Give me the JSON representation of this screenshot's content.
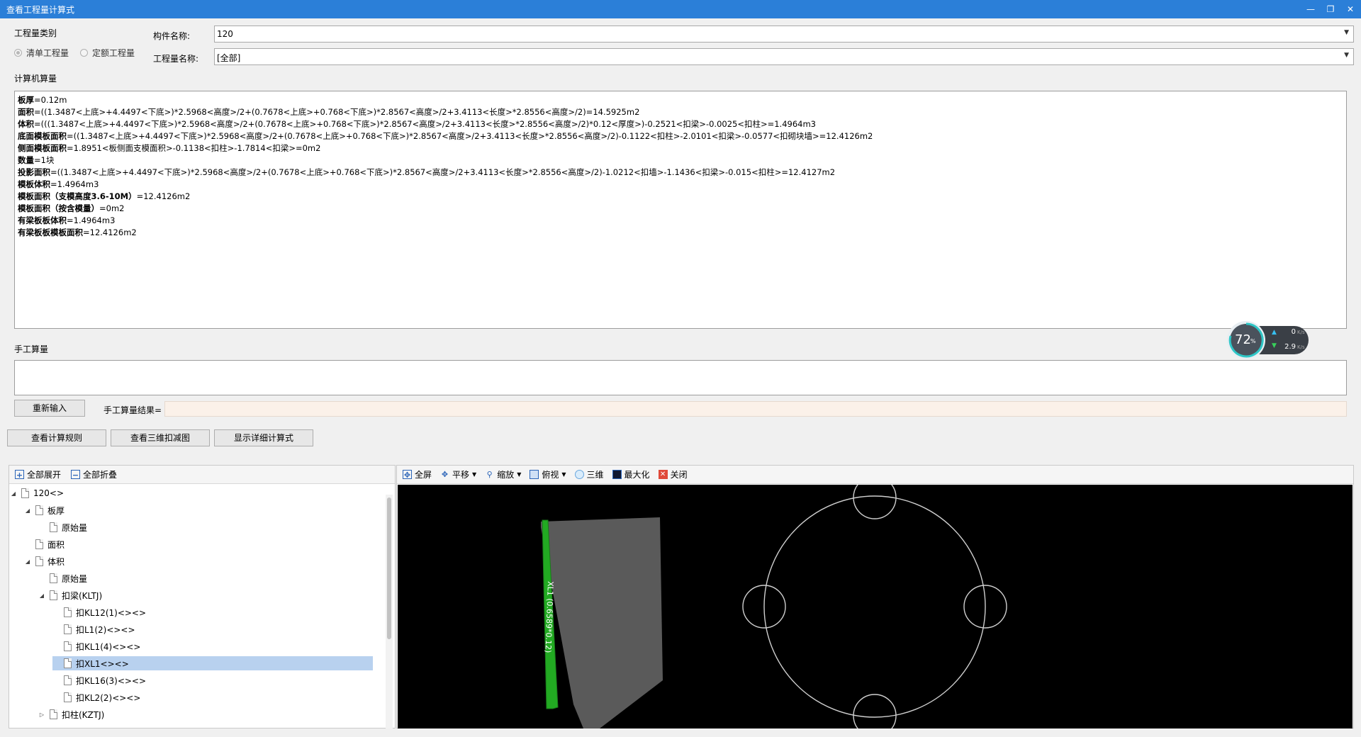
{
  "window": {
    "title": "查看工程量计算式"
  },
  "quantity_type": {
    "group_label": "工程量类别",
    "options": [
      {
        "label": "清单工程量",
        "selected": true
      },
      {
        "label": "定额工程量",
        "selected": false
      }
    ]
  },
  "component": {
    "label": "构件名称:",
    "value": "120"
  },
  "quantity_name": {
    "label": "工程量名称:",
    "value": "[全部]"
  },
  "computer_calc": {
    "label": "计算机算量",
    "lines": [
      {
        "key": "板厚",
        "text": "=0.12m"
      },
      {
        "key": "面积",
        "text": "=((1.3487<上底>+4.4497<下底>)*2.5968<高度>/2+(0.7678<上底>+0.768<下底>)*2.8567<高度>/2+3.4113<长度>*2.8556<高度>/2)=14.5925m2"
      },
      {
        "key": "体积",
        "text": "=(((1.3487<上底>+4.4497<下底>)*2.5968<高度>/2+(0.7678<上底>+0.768<下底>)*2.8567<高度>/2+3.4113<长度>*2.8556<高度>/2)*0.12<厚度>)-0.2521<扣梁>-0.0025<扣柱>=1.4964m3"
      },
      {
        "key": "底面模板面积",
        "text": "=((1.3487<上底>+4.4497<下底>)*2.5968<高度>/2+(0.7678<上底>+0.768<下底>)*2.8567<高度>/2+3.4113<长度>*2.8556<高度>/2)-0.1122<扣柱>-2.0101<扣梁>-0.0577<扣砌块墙>=12.4126m2"
      },
      {
        "key": "侧面模板面积",
        "text": "=1.8951<板侧面支模面积>-0.1138<扣柱>-1.7814<扣梁>=0m2"
      },
      {
        "key": "数量",
        "text": "=1块"
      },
      {
        "key": "投影面积",
        "text": "=((1.3487<上底>+4.4497<下底>)*2.5968<高度>/2+(0.7678<上底>+0.768<下底>)*2.8567<高度>/2+3.4113<长度>*2.8556<高度>/2)-1.0212<扣墙>-1.1436<扣梁>-0.015<扣柱>=12.4127m2"
      },
      {
        "key": "模板体积",
        "text": "=1.4964m3"
      },
      {
        "key": "模板面积（支模高度3.6-10M）",
        "text": "=12.4126m2"
      },
      {
        "key": "模板面积（按含模量）",
        "text": "=0m2"
      },
      {
        "key": "有梁板板体积",
        "text": "=1.4964m3"
      },
      {
        "key": "有梁板板模板面积",
        "text": "=12.4126m2"
      }
    ]
  },
  "manual_calc": {
    "label": "手工算量",
    "reenter_button": "重新输入",
    "result_label": "手工算量结果="
  },
  "actions": {
    "view_rules": "查看计算规则",
    "view_3d": "查看三维扣减图",
    "show_detail": "显示详细计算式"
  },
  "tree_toolbar": {
    "expand_all": "全部展开",
    "collapse_all": "全部折叠"
  },
  "tree": [
    {
      "label": "120<>",
      "level": 0,
      "expander": "open"
    },
    {
      "label": "板厚",
      "level": 1,
      "expander": "open"
    },
    {
      "label": "原始量",
      "level": 2,
      "expander": "none"
    },
    {
      "label": "面积",
      "level": 1,
      "expander": "none"
    },
    {
      "label": "体积",
      "level": 1,
      "expander": "open"
    },
    {
      "label": "原始量",
      "level": 2,
      "expander": "none"
    },
    {
      "label": "扣梁(KLTJ)",
      "level": 2,
      "expander": "open"
    },
    {
      "label": "扣KL12(1)<><>",
      "level": 3,
      "expander": "none"
    },
    {
      "label": "扣L1(2)<><>",
      "level": 3,
      "expander": "none"
    },
    {
      "label": "扣KL1(4)<><>",
      "level": 3,
      "expander": "none"
    },
    {
      "label": "扣XL1<><>",
      "level": 3,
      "expander": "none",
      "selected": true
    },
    {
      "label": "扣KL16(3)<><>",
      "level": 3,
      "expander": "none"
    },
    {
      "label": "扣KL2(2)<><>",
      "level": 3,
      "expander": "none"
    },
    {
      "label": "扣柱(KZTJ)",
      "level": 2,
      "expander": "closed"
    }
  ],
  "viewer_toolbar": {
    "fullscreen": "全屏",
    "pan": "平移",
    "zoom": "缩放",
    "top_view": "俯视",
    "three_d": "三维",
    "maximize": "最大化",
    "close": "关闭"
  },
  "viewer": {
    "beam_label": "XL1 (0.6589*0.12)"
  },
  "speed_widget": {
    "percent": "72",
    "percent_unit": "%",
    "up": "0",
    "down": "2.9",
    "unit": "K/s"
  },
  "colors": {
    "titlebar": "#2b7fd8",
    "selection": "#b8d1ef",
    "beam": "#22aa22",
    "slab": "#5a5a5a"
  }
}
